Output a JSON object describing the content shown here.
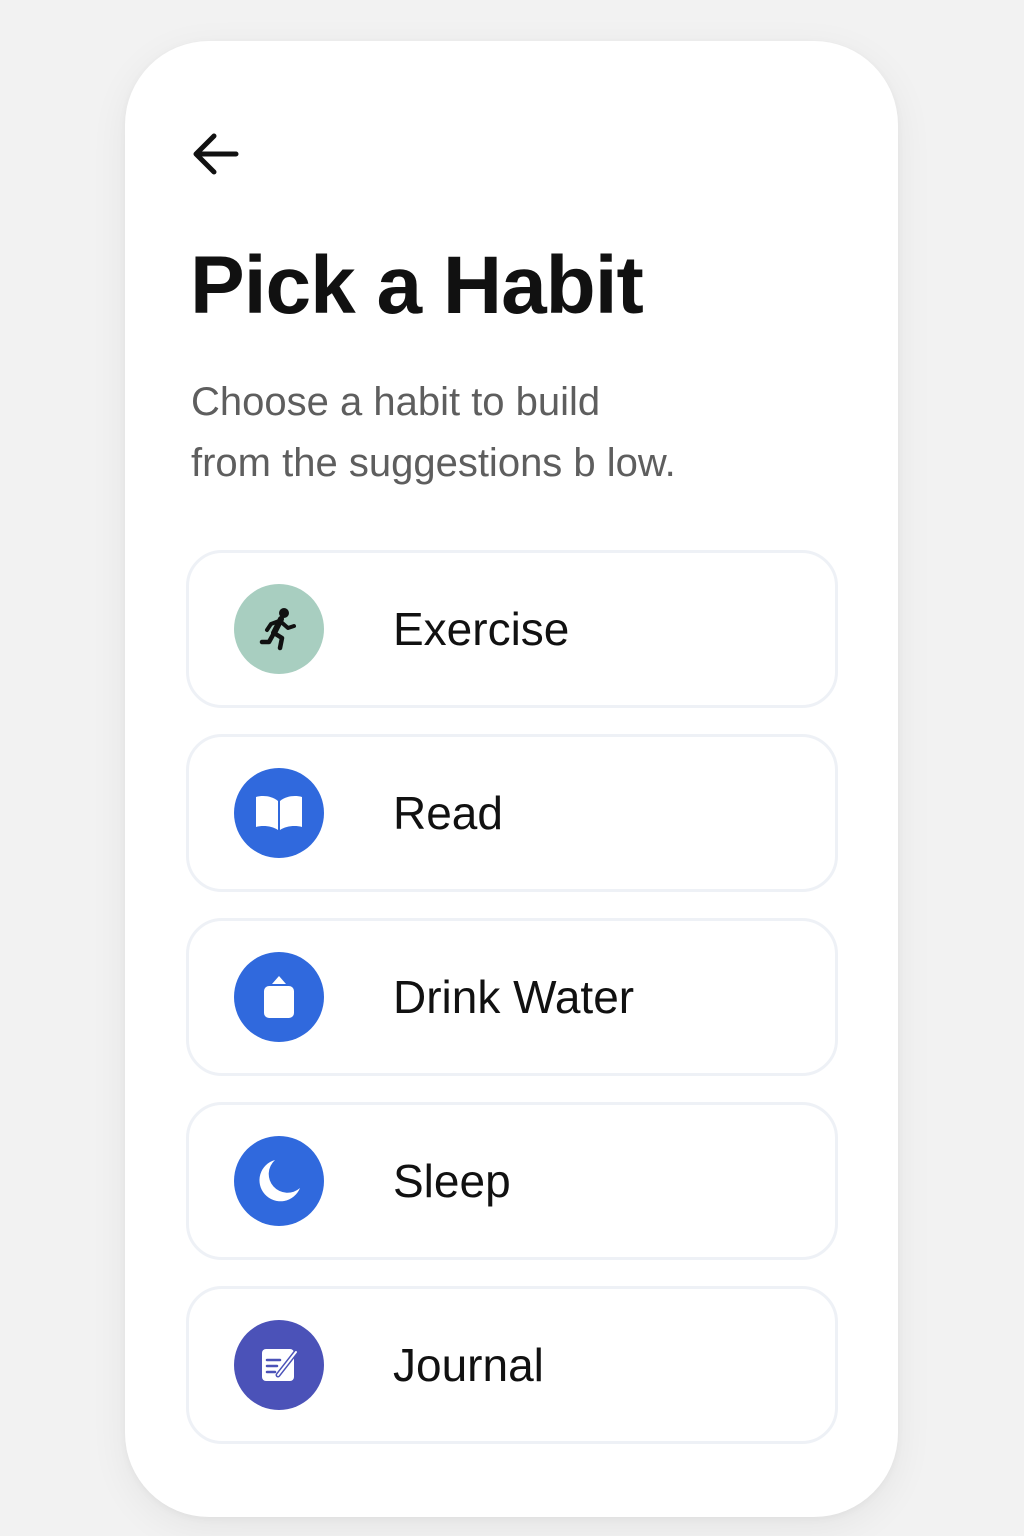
{
  "header": {
    "back_icon": "arrow-left-icon",
    "title": "Pick a Habit",
    "subtitle_lines": [
      "Choose a habit to build",
      "from the suggestions b low."
    ]
  },
  "habits": [
    {
      "label": "Exercise",
      "icon": "running-person-icon",
      "icon_bg": "#a8cec0",
      "icon_fg": "#111111"
    },
    {
      "label": "Read",
      "icon": "open-book-icon",
      "icon_bg": "#3069dd",
      "icon_fg": "#ffffff"
    },
    {
      "label": "Drink Water",
      "icon": "water-bottle-icon",
      "icon_bg": "#3069dd",
      "icon_fg": "#ffffff"
    },
    {
      "label": "Sleep",
      "icon": "crescent-moon-icon",
      "icon_bg": "#3069dd",
      "icon_fg": "#ffffff"
    },
    {
      "label": "Journal",
      "icon": "journal-pen-icon",
      "icon_bg": "#4b52b8",
      "icon_fg": "#ffffff"
    }
  ],
  "colors": {
    "background": "#f2f2f2",
    "card": "#ffffff",
    "card_border": "#eef1f6",
    "title": "#111111",
    "subtitle": "#5e5e5e"
  }
}
